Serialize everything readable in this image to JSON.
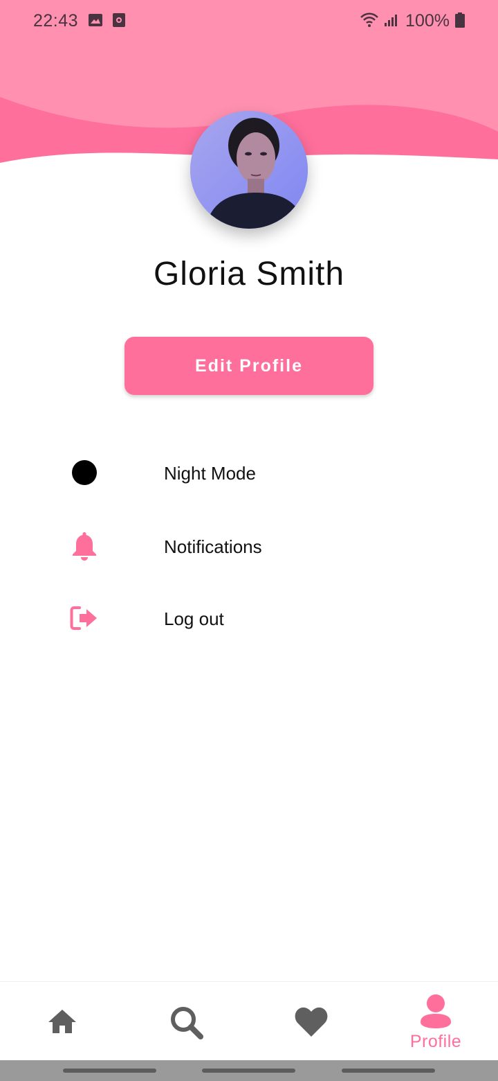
{
  "status_bar": {
    "time": "22:43",
    "battery": "100%",
    "icons": [
      "image-icon",
      "screen-record-icon",
      "wifi-icon",
      "signal-icon",
      "battery-icon"
    ]
  },
  "profile": {
    "name": "Gloria Smith",
    "edit_button_label": "Edit Profile"
  },
  "menu": [
    {
      "label": "Night Mode",
      "icon": "night-mode-circle-icon"
    },
    {
      "label": "Notifications",
      "icon": "bell-icon"
    },
    {
      "label": "Log out",
      "icon": "logout-icon"
    }
  ],
  "bottom_nav": {
    "items": [
      {
        "icon": "home-icon",
        "label": ""
      },
      {
        "icon": "search-icon",
        "label": ""
      },
      {
        "icon": "heart-icon",
        "label": ""
      },
      {
        "icon": "profile-icon",
        "label": "Profile",
        "active": true
      }
    ]
  },
  "colors": {
    "accent": "#ff6f9c",
    "header_light": "#ff8fb0",
    "icon_gray": "#5f5f5f"
  }
}
